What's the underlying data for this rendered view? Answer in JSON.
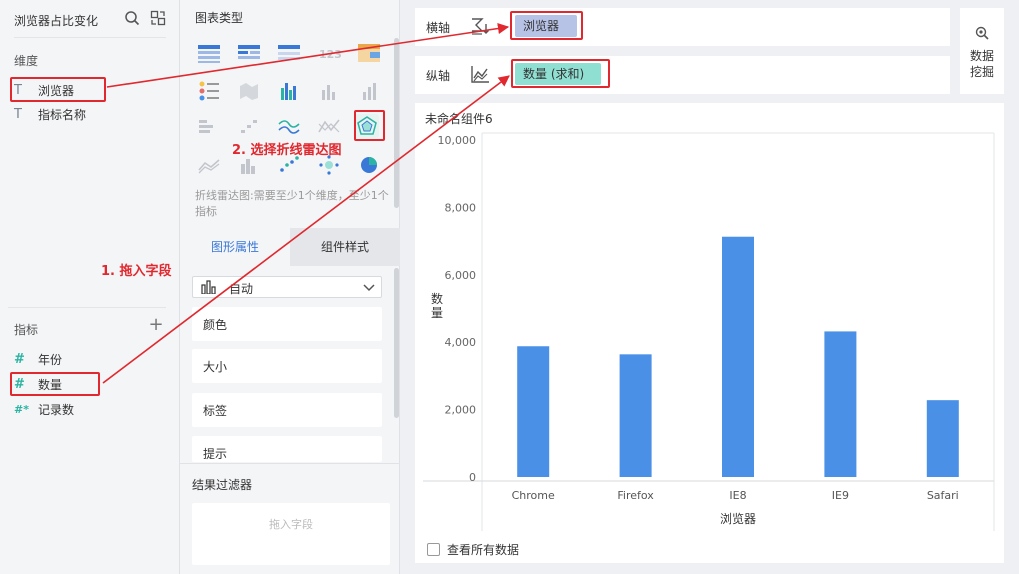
{
  "dataset": {
    "title": "浏览器占比变化",
    "dimension_section": "维度",
    "dimensions": [
      {
        "type": "T",
        "name": "浏览器"
      },
      {
        "type": "T",
        "name": "指标名称"
      }
    ],
    "measure_section": "指标",
    "measures": [
      {
        "type": "#",
        "name": "年份"
      },
      {
        "type": "#",
        "name": "数量"
      },
      {
        "type": "#*",
        "name": "记录数"
      }
    ]
  },
  "chart_types": {
    "title": "图表类型",
    "description": "折线雷达图:需要至少1个维度，至少1个指标"
  },
  "property_tabs": {
    "active": "图形属性",
    "inactive": "组件样式"
  },
  "properties": {
    "mode": "自动",
    "items": [
      "颜色",
      "大小",
      "标签",
      "提示"
    ]
  },
  "filter": {
    "title": "结果过滤器",
    "placeholder": "拖入字段"
  },
  "axes": {
    "x_label": "横轴",
    "x_field": "浏览器",
    "y_label": "纵轴",
    "y_field": "数量 (求和)"
  },
  "mining": {
    "label_line1": "数据",
    "label_line2": "挖掘"
  },
  "chart_card": {
    "title": "未命名组件6",
    "show_all": "查看所有数据"
  },
  "annotations": {
    "step1": "1. 拖入字段",
    "step2": "2. 选择折线雷达图"
  },
  "colors": {
    "accent": "#3a78d8",
    "bar": "#4a90e6",
    "annotation": "#e0282e",
    "y_pill": "#8fe0d3",
    "x_pill": "#b7c3e6"
  },
  "chart_data": {
    "type": "bar",
    "categories": [
      "Chrome",
      "Firefox",
      "IE8",
      "IE9",
      "Safari"
    ],
    "values": [
      3880,
      3640,
      7130,
      4320,
      2280
    ],
    "xlabel": "浏览器",
    "ylabel": "数量",
    "ylim": [
      0,
      10000
    ],
    "yticks": [
      "0",
      "2,000",
      "4,000",
      "6,000",
      "8,000",
      "10,000"
    ],
    "ytick_values": [
      0,
      2000,
      4000,
      6000,
      8000,
      10000
    ],
    "grid": false
  }
}
